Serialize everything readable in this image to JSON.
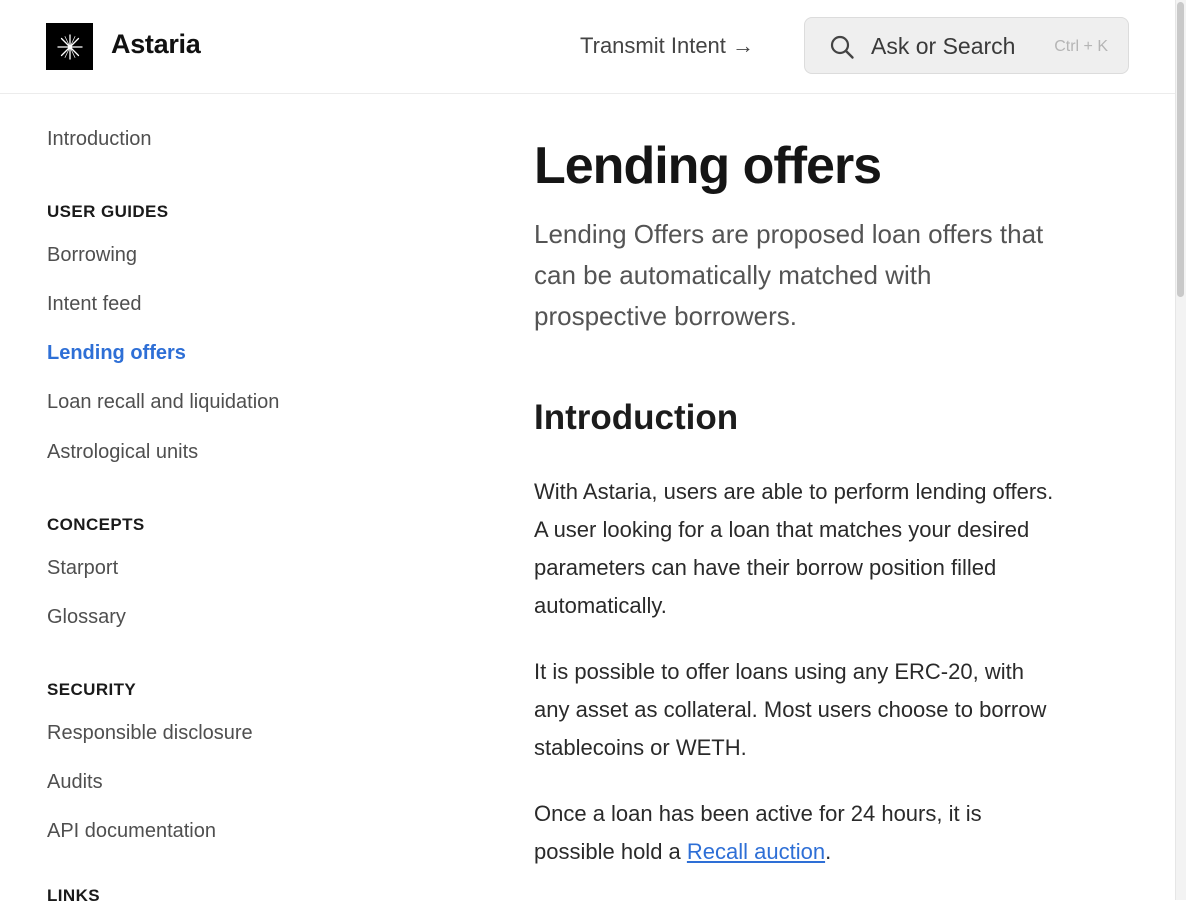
{
  "header": {
    "brand": "Astaria",
    "transmit_label": "Transmit Intent →",
    "search": {
      "placeholder": "Ask or Search",
      "shortcut": "Ctrl + K"
    }
  },
  "sidebar": {
    "intro": "Introduction",
    "sections": [
      {
        "heading": "USER GUIDES",
        "items": [
          "Borrowing",
          "Intent feed",
          "Lending offers",
          "Loan recall and liquidation",
          "Astrological units"
        ]
      },
      {
        "heading": "CONCEPTS",
        "items": [
          "Starport",
          "Glossary"
        ]
      },
      {
        "heading": "SECURITY",
        "items": [
          "Responsible disclosure",
          "Audits",
          "API documentation"
        ]
      },
      {
        "heading": "LINKS"
      }
    ],
    "active_item": "Lending offers"
  },
  "article": {
    "title": "Lending offers",
    "lead": "Lending Offers are proposed loan offers that can be automatically matched with prospective borrowers.",
    "section_heading": "Introduction",
    "p1": "With Astaria, users are able to perform lending offers. A user looking for a loan that matches your desired parameters can have their borrow position filled automatically.",
    "p2": "It is possible to offer loans using any ERC-20, with any asset as collateral. Most users choose to borrow stablecoins or WETH.",
    "p3_before": "Once a loan has been active for 24 hours, it is possible hold a ",
    "p3_link": "Recall auction",
    "p3_after": "."
  },
  "colors": {
    "accent": "#2e6fd6",
    "text": "#1f1f1f",
    "muted": "#4f4f4f"
  }
}
